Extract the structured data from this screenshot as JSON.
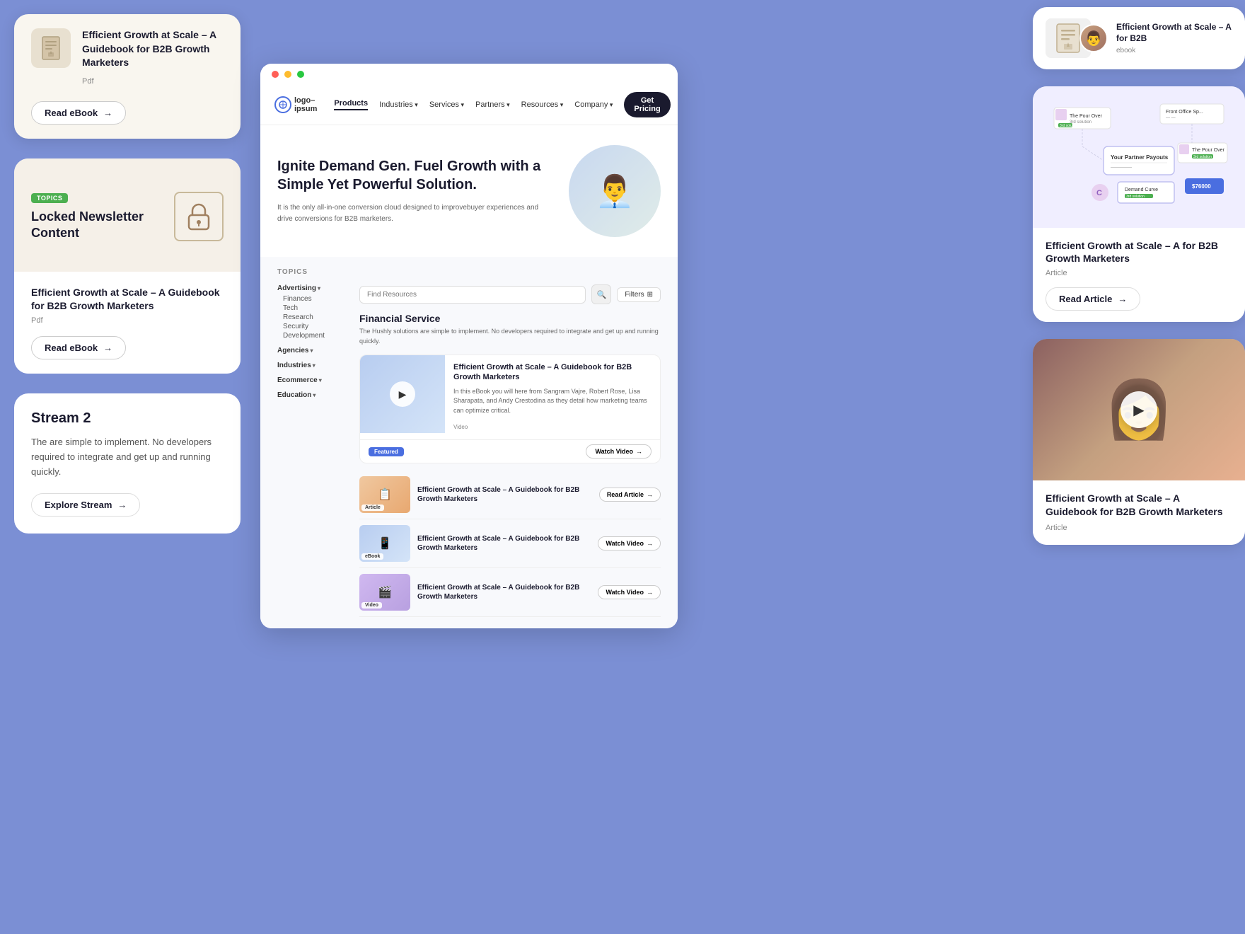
{
  "page": {
    "bg_color": "#7b8fd4"
  },
  "card_ebook": {
    "title": "Efficient Growth at Scale – A Guidebook for B2B Growth Marketers",
    "tag": "Pdf",
    "btn_label": "Read eBook",
    "icon": "📄"
  },
  "card_locked": {
    "badge": "Topics",
    "title": "Locked Newsletter Content",
    "subtitle": "Efficient Growth at Scale – A Guidebook for B2B Growth Marketers",
    "tag": "Pdf",
    "btn_label": "Read eBook"
  },
  "card_stream": {
    "title": "Stream 2",
    "description": "The are simple to implement. No developers required to integrate and get up and running quickly.",
    "btn_label": "Explore Stream"
  },
  "browser": {
    "nav": {
      "logo": "logo–ipsum",
      "links": [
        "Products",
        "Industries",
        "Services",
        "Partners",
        "Resources",
        "Company"
      ],
      "active": "Products",
      "cta": "Get Pricing"
    },
    "hero": {
      "title": "Ignite Demand Gen. Fuel Growth with a Simple Yet Powerful Solution.",
      "description": "It is the only all-in-one conversion cloud designed to improvebuyer experiences and drive conversions for B2B marketers."
    },
    "topics_label": "TOPICS",
    "search_placeholder": "Find Resources",
    "filter_btn": "Filters",
    "sidebar_topics": {
      "advertising": "Advertising",
      "sub_advertising": [
        "Finances",
        "Tech",
        "Research",
        "Security",
        "Development"
      ],
      "agencies": "Agencies",
      "industries": "Industries",
      "ecommerce": "Ecommerce",
      "education": "Education"
    },
    "section": {
      "title": "Financial Service",
      "description": "The Hushly solutions are simple to implement. No developers required to integrate and get up and running quickly."
    },
    "featured": {
      "title": "Efficient Growth at Scale – A Guidebook for B2B Growth Marketers",
      "description": "In this eBook you will here from Sangram Vajre, Robert Rose, Lisa Sharapata, and Andy Crestodina as they detail how marketing teams can optimize critical.",
      "video_tag": "Video",
      "badge": "Featured",
      "watch_btn": "Watch Video"
    },
    "list_items": [
      {
        "title": "Efficient Growth at Scale – A Guidebook for B2B Growth Marketers",
        "tag": "Article",
        "cta": "Read Article",
        "thumb_type": "orange"
      },
      {
        "title": "Efficient Growth at Scale – A Guidebook for B2B Growth Marketers",
        "tag": "eBook",
        "cta": "Watch Video",
        "thumb_type": "blue"
      },
      {
        "title": "Efficient Growth at Scale – A Guidebook for B2B Growth Marketers",
        "tag": "Video",
        "cta": "Watch Video",
        "thumb_type": "purple"
      }
    ]
  },
  "right_col": {
    "card_sm": {
      "title": "Efficient Growth at Scale – A for B2B",
      "tag": "ebook"
    },
    "card_article": {
      "title": "Efficient Growth at Scale – A for B2B Growth Marketers",
      "tag": "Article",
      "btn_label": "Read Article"
    },
    "card_video": {
      "title": "Efficient Growth at Scale – A Guidebook for B2B Growth Marketers",
      "tag": "Article"
    }
  }
}
